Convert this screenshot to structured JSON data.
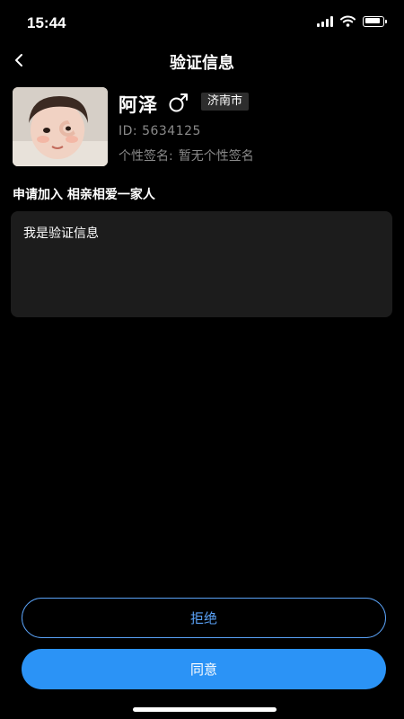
{
  "status_bar": {
    "time": "15:44",
    "battery_level": 0.9
  },
  "nav": {
    "title": "验证信息"
  },
  "profile": {
    "name": "阿泽",
    "gender_icon": "male-icon",
    "city": "济南市",
    "id_text": "ID: 5634125",
    "signature_label": "个性签名:",
    "signature_value": "暂无个性签名"
  },
  "request": {
    "apply_text": "申请加入 相亲相爱一家人",
    "message": "我是验证信息"
  },
  "actions": {
    "reject_label": "拒绝",
    "agree_label": "同意"
  },
  "colors": {
    "accent": "#2b93f6",
    "outline": "#5aa2f7",
    "box_bg": "#1c1c1c"
  }
}
